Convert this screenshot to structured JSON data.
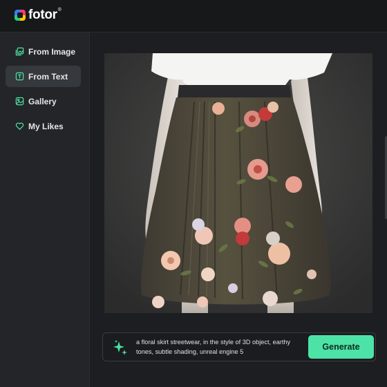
{
  "brand": {
    "name": "fotor",
    "reg_mark": "®"
  },
  "sidebar": {
    "items": [
      {
        "label": "From Image",
        "icon": "image-icon",
        "active": false
      },
      {
        "label": "From Text",
        "icon": "text-icon",
        "active": true
      },
      {
        "label": "Gallery",
        "icon": "gallery-icon",
        "active": false
      },
      {
        "label": "My Likes",
        "icon": "heart-icon",
        "active": false
      }
    ]
  },
  "main": {
    "preview": {
      "subject": "floral skirt streetwear render",
      "alt": "Generated image preview"
    }
  },
  "prompt": {
    "text": "a floral skirt streetwear, in the style of 3D object, earthy tones, subtle shading, unreal engine 5",
    "icon": "sparkle-icon"
  },
  "generate": {
    "label": "Generate"
  },
  "colors": {
    "accent": "#4de3a6",
    "background": "#1e2023",
    "sidebar": "#232528",
    "active_item": "#35383c"
  }
}
